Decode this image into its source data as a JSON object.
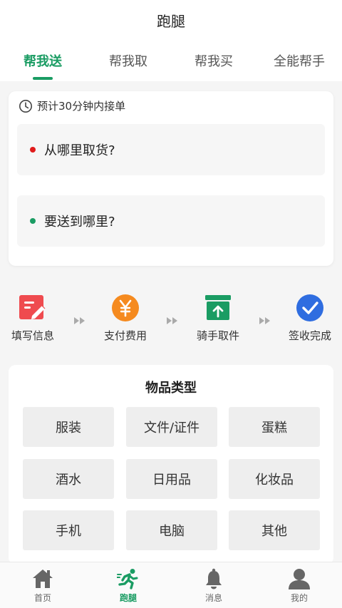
{
  "header": {
    "title": "跑腿"
  },
  "tabs": [
    {
      "label": "帮我送",
      "active": true
    },
    {
      "label": "帮我取",
      "active": false
    },
    {
      "label": "帮我买",
      "active": false
    },
    {
      "label": "全能帮手",
      "active": false
    }
  ],
  "address_card": {
    "eta_icon": "clock-icon",
    "eta_text": "预计30分钟内接单",
    "pickup_placeholder": "从哪里取货?",
    "dropoff_placeholder": "要送到哪里?"
  },
  "steps": [
    {
      "label": "填写信息",
      "icon": "edit-form-icon",
      "color": "#ef4b4f"
    },
    {
      "label": "支付费用",
      "icon": "yuan-coin-icon",
      "color": "#f58a1f"
    },
    {
      "label": "骑手取件",
      "icon": "pickup-box-icon",
      "color": "#1a9c63"
    },
    {
      "label": "签收完成",
      "icon": "check-circle-icon",
      "color": "#2f6de0"
    }
  ],
  "item_types": {
    "title": "物品类型",
    "items": [
      "服装",
      "文件/证件",
      "蛋糕",
      "酒水",
      "日用品",
      "化妆品",
      "手机",
      "电脑",
      "其他"
    ]
  },
  "tabbar": [
    {
      "label": "首页",
      "icon": "home-icon",
      "active": false
    },
    {
      "label": "跑腿",
      "icon": "runner-icon",
      "active": true
    },
    {
      "label": "消息",
      "icon": "bell-icon",
      "active": false
    },
    {
      "label": "我的",
      "icon": "user-icon",
      "active": false
    }
  ],
  "colors": {
    "accent": "#1a9c63",
    "pickup_dot": "#e01b1b",
    "dropoff_dot": "#1a9c63"
  }
}
